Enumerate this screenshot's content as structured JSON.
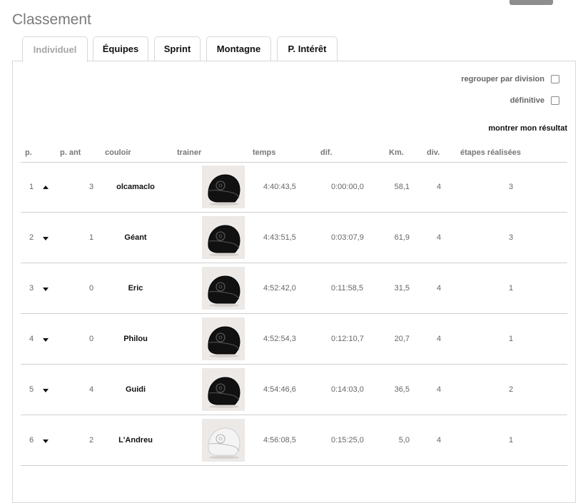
{
  "page": {
    "title": "Classement"
  },
  "tabs": [
    {
      "label": "Individuel",
      "active": true
    },
    {
      "label": "Équipes",
      "active": false
    },
    {
      "label": "Sprint",
      "active": false
    },
    {
      "label": "Montagne",
      "active": false
    },
    {
      "label": "P. Intérêt",
      "active": false
    }
  ],
  "options": {
    "group_by_division": {
      "label": "regrouper par division",
      "checked": false
    },
    "final": {
      "label": "définitive",
      "checked": false
    },
    "show_my_result": "montrer mon résultat"
  },
  "table": {
    "columns": [
      "p.",
      "p. ant",
      "couloir",
      "trainer",
      "temps",
      "dif.",
      "Km.",
      "div.",
      "étapes réalisées"
    ],
    "rows": [
      {
        "pos": "1",
        "trend": "up",
        "prev": "3",
        "name": "olcamaclo",
        "trainer_icon": "helmet-dark-icon",
        "time": "4:40:43,5",
        "diff": "0:00:00,0",
        "km": "58,1",
        "div": "4",
        "stages": "3"
      },
      {
        "pos": "2",
        "trend": "down",
        "prev": "1",
        "name": "Géant",
        "trainer_icon": "helmet-dark-icon",
        "time": "4:43:51,5",
        "diff": "0:03:07,9",
        "km": "61,9",
        "div": "4",
        "stages": "3"
      },
      {
        "pos": "3",
        "trend": "down",
        "prev": "0",
        "name": "Eric",
        "trainer_icon": "helmet-dark-icon",
        "time": "4:52:42,0",
        "diff": "0:11:58,5",
        "km": "31,5",
        "div": "4",
        "stages": "1"
      },
      {
        "pos": "4",
        "trend": "down",
        "prev": "0",
        "name": "Philou",
        "trainer_icon": "helmet-dark-icon",
        "time": "4:52:54,3",
        "diff": "0:12:10,7",
        "km": "20,7",
        "div": "4",
        "stages": "1"
      },
      {
        "pos": "5",
        "trend": "down",
        "prev": "4",
        "name": "Guidi",
        "trainer_icon": "helmet-dark-icon",
        "time": "4:54:46,6",
        "diff": "0:14:03,0",
        "km": "36,5",
        "div": "4",
        "stages": "2"
      },
      {
        "pos": "6",
        "trend": "down",
        "prev": "2",
        "name": "L'Andreu",
        "trainer_icon": "helmet-white-icon",
        "time": "4:56:08,5",
        "diff": "0:15:25,0",
        "km": "5,0",
        "div": "4",
        "stages": "1"
      }
    ]
  },
  "colors": {
    "helmet_dark": "#111111",
    "helmet_white": "#f4f4f4",
    "avatar_bg": "#ece9e7",
    "active_tab_text": "#a6a6a6"
  }
}
